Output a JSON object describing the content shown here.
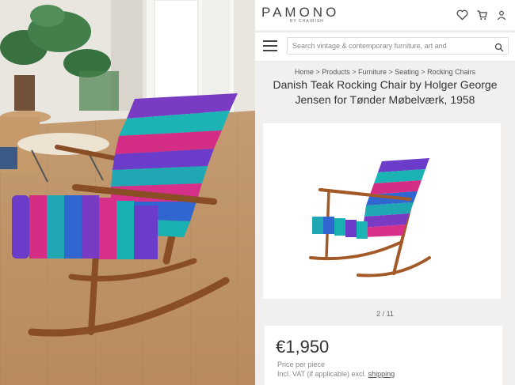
{
  "brand": {
    "logo": "PAMONO",
    "sub": "BY CHAIRISH"
  },
  "icons": [
    "heart-icon",
    "cart-icon",
    "user-icon",
    "menu-icon",
    "search-icon"
  ],
  "search": {
    "placeholder": "Search vintage & contemporary furniture, art and"
  },
  "breadcrumb": [
    "Home",
    "Products",
    "Furniture",
    "Seating",
    "Rocking Chairs"
  ],
  "product": {
    "title_line1": "Danish Teak Rocking Chair by Holger George",
    "title_line2": "Jensen for Tønder Møbelværk, 1958",
    "image_counter": "2 / 11",
    "price": "€1,950",
    "price_label": "Price per piece",
    "vat_text": "Incl. VAT (if applicable) excl.",
    "shipping_link": "shipping"
  },
  "colors": {
    "accent": "#333333",
    "teak": "#9a5a2c",
    "stripe_teal": "#20b2b6",
    "stripe_purple": "#6a3cc9",
    "stripe_pink": "#d6308a",
    "stripe_blue": "#2f66d0"
  }
}
